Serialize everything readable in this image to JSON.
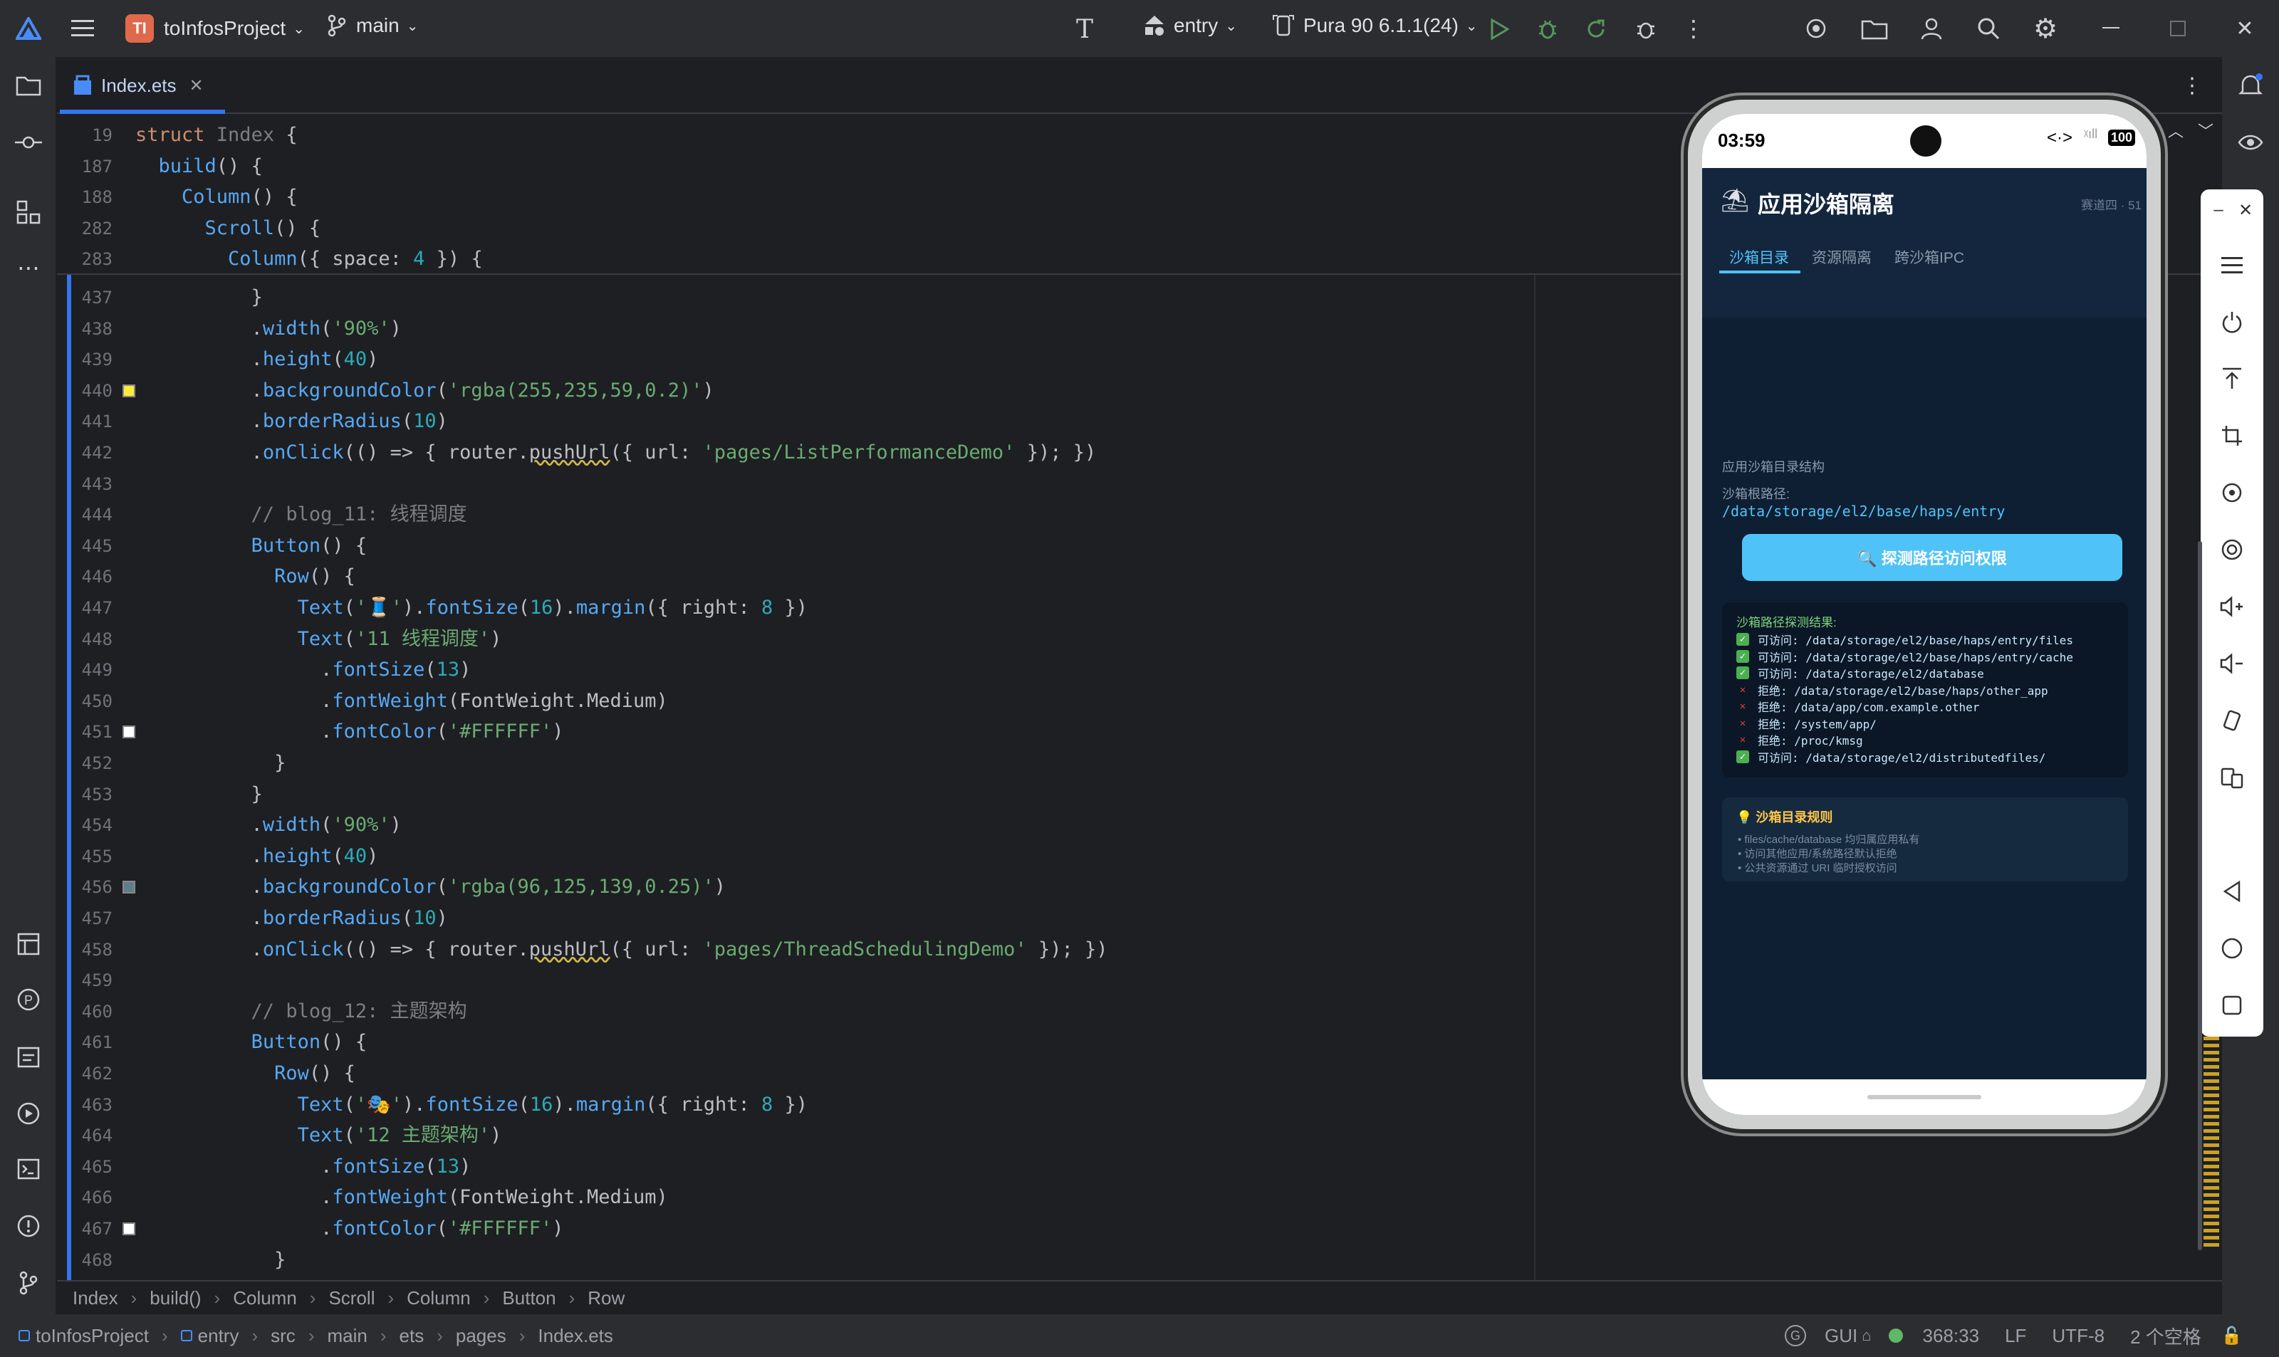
{
  "titlebar": {
    "project_badge": "TI",
    "project_name": "toInfosProject",
    "branch": "main",
    "run_config": "entry",
    "device": "Pura 90 6.1.1(24)"
  },
  "tab": {
    "file_name": "Index.ets"
  },
  "sticky_lines": [
    {
      "ln": "19",
      "tokens": [
        [
          "k",
          "struct "
        ],
        [
          "c",
          "Index "
        ],
        [
          "t",
          "{"
        ]
      ]
    },
    {
      "ln": "187",
      "tokens": [
        [
          "t",
          "  "
        ],
        [
          "f",
          "build"
        ],
        [
          "t",
          "() {"
        ]
      ]
    },
    {
      "ln": "188",
      "tokens": [
        [
          "t",
          "    "
        ],
        [
          "f",
          "Column"
        ],
        [
          "t",
          "() {"
        ]
      ]
    },
    {
      "ln": "282",
      "tokens": [
        [
          "t",
          "      "
        ],
        [
          "f",
          "Scroll"
        ],
        [
          "t",
          "() {"
        ]
      ]
    },
    {
      "ln": "283",
      "tokens": [
        [
          "t",
          "        "
        ],
        [
          "f",
          "Column"
        ],
        [
          "t",
          "({ space: "
        ],
        [
          "n",
          "4"
        ],
        [
          "t",
          " }) {"
        ]
      ]
    }
  ],
  "code_lines": [
    {
      "ln": "437",
      "tokens": [
        [
          "t",
          "          }"
        ]
      ]
    },
    {
      "ln": "438",
      "tokens": [
        [
          "t",
          "          ."
        ],
        [
          "f",
          "width"
        ],
        [
          "t",
          "("
        ],
        [
          "s",
          "'90%'"
        ],
        [
          "t",
          ")"
        ]
      ]
    },
    {
      "ln": "439",
      "tokens": [
        [
          "t",
          "          ."
        ],
        [
          "f",
          "height"
        ],
        [
          "t",
          "("
        ],
        [
          "n",
          "40"
        ],
        [
          "t",
          ")"
        ]
      ]
    },
    {
      "ln": "440",
      "tokens": [
        [
          "t",
          "          ."
        ],
        [
          "f",
          "backgroundColor"
        ],
        [
          "t",
          "("
        ],
        [
          "s",
          "'rgba(255,235,59,0.2)'"
        ],
        [
          "t",
          ")"
        ]
      ]
    },
    {
      "ln": "441",
      "tokens": [
        [
          "t",
          "          ."
        ],
        [
          "f",
          "borderRadius"
        ],
        [
          "t",
          "("
        ],
        [
          "n",
          "10"
        ],
        [
          "t",
          ")"
        ]
      ]
    },
    {
      "ln": "442",
      "tokens": [
        [
          "t",
          "          ."
        ],
        [
          "f",
          "onClick"
        ],
        [
          "t",
          "(() => { router."
        ],
        [
          "u",
          "pushUrl"
        ],
        [
          "t",
          "({ url: "
        ],
        [
          "s",
          "'pages/ListPerformanceDemo'"
        ],
        [
          "t",
          " }); })"
        ]
      ]
    },
    {
      "ln": "443",
      "tokens": [
        [
          "t",
          ""
        ]
      ]
    },
    {
      "ln": "444",
      "tokens": [
        [
          "c",
          "          // blog_11: 线程调度"
        ]
      ]
    },
    {
      "ln": "445",
      "tokens": [
        [
          "t",
          "          "
        ],
        [
          "f",
          "Button"
        ],
        [
          "t",
          "() {"
        ]
      ]
    },
    {
      "ln": "446",
      "tokens": [
        [
          "t",
          "            "
        ],
        [
          "f",
          "Row"
        ],
        [
          "t",
          "() {"
        ]
      ]
    },
    {
      "ln": "447",
      "tokens": [
        [
          "t",
          "              "
        ],
        [
          "f",
          "Text"
        ],
        [
          "t",
          "("
        ],
        [
          "s",
          "'🧵'"
        ],
        [
          "t",
          ")."
        ],
        [
          "f",
          "fontSize"
        ],
        [
          "t",
          "("
        ],
        [
          "n",
          "16"
        ],
        [
          "t",
          ")."
        ],
        [
          "f",
          "margin"
        ],
        [
          "t",
          "({ right: "
        ],
        [
          "n",
          "8"
        ],
        [
          "t",
          " })"
        ]
      ]
    },
    {
      "ln": "448",
      "tokens": [
        [
          "t",
          "              "
        ],
        [
          "f",
          "Text"
        ],
        [
          "t",
          "("
        ],
        [
          "s",
          "'11 线程调度'"
        ],
        [
          "t",
          ")"
        ]
      ]
    },
    {
      "ln": "449",
      "tokens": [
        [
          "t",
          "                ."
        ],
        [
          "f",
          "fontSize"
        ],
        [
          "t",
          "("
        ],
        [
          "n",
          "13"
        ],
        [
          "t",
          ")"
        ]
      ]
    },
    {
      "ln": "450",
      "tokens": [
        [
          "t",
          "                ."
        ],
        [
          "f",
          "fontWeight"
        ],
        [
          "t",
          "(FontWeight.Medium)"
        ]
      ]
    },
    {
      "ln": "451",
      "tokens": [
        [
          "t",
          "                ."
        ],
        [
          "f",
          "fontColor"
        ],
        [
          "t",
          "("
        ],
        [
          "s",
          "'#FFFFFF'"
        ],
        [
          "t",
          ")"
        ]
      ]
    },
    {
      "ln": "452",
      "tokens": [
        [
          "t",
          "            }"
        ]
      ]
    },
    {
      "ln": "453",
      "tokens": [
        [
          "t",
          "          }"
        ]
      ]
    },
    {
      "ln": "454",
      "tokens": [
        [
          "t",
          "          ."
        ],
        [
          "f",
          "width"
        ],
        [
          "t",
          "("
        ],
        [
          "s",
          "'90%'"
        ],
        [
          "t",
          ")"
        ]
      ]
    },
    {
      "ln": "455",
      "tokens": [
        [
          "t",
          "          ."
        ],
        [
          "f",
          "height"
        ],
        [
          "t",
          "("
        ],
        [
          "n",
          "40"
        ],
        [
          "t",
          ")"
        ]
      ]
    },
    {
      "ln": "456",
      "tokens": [
        [
          "t",
          "          ."
        ],
        [
          "f",
          "backgroundColor"
        ],
        [
          "t",
          "("
        ],
        [
          "s",
          "'rgba(96,125,139,0.25)'"
        ],
        [
          "t",
          ")"
        ]
      ]
    },
    {
      "ln": "457",
      "tokens": [
        [
          "t",
          "          ."
        ],
        [
          "f",
          "borderRadius"
        ],
        [
          "t",
          "("
        ],
        [
          "n",
          "10"
        ],
        [
          "t",
          ")"
        ]
      ]
    },
    {
      "ln": "458",
      "tokens": [
        [
          "t",
          "          ."
        ],
        [
          "f",
          "onClick"
        ],
        [
          "t",
          "(() => { router."
        ],
        [
          "u",
          "pushUrl"
        ],
        [
          "t",
          "({ url: "
        ],
        [
          "s",
          "'pages/ThreadSchedulingDemo'"
        ],
        [
          "t",
          " }); })"
        ]
      ]
    },
    {
      "ln": "459",
      "tokens": [
        [
          "t",
          ""
        ]
      ]
    },
    {
      "ln": "460",
      "tokens": [
        [
          "c",
          "          // blog_12: 主题架构"
        ]
      ]
    },
    {
      "ln": "461",
      "tokens": [
        [
          "t",
          "          "
        ],
        [
          "f",
          "Button"
        ],
        [
          "t",
          "() {"
        ]
      ]
    },
    {
      "ln": "462",
      "tokens": [
        [
          "t",
          "            "
        ],
        [
          "f",
          "Row"
        ],
        [
          "t",
          "() {"
        ]
      ]
    },
    {
      "ln": "463",
      "tokens": [
        [
          "t",
          "              "
        ],
        [
          "f",
          "Text"
        ],
        [
          "t",
          "("
        ],
        [
          "s",
          "'🎭'"
        ],
        [
          "t",
          ")."
        ],
        [
          "f",
          "fontSize"
        ],
        [
          "t",
          "("
        ],
        [
          "n",
          "16"
        ],
        [
          "t",
          ")."
        ],
        [
          "f",
          "margin"
        ],
        [
          "t",
          "({ right: "
        ],
        [
          "n",
          "8"
        ],
        [
          "t",
          " })"
        ]
      ]
    },
    {
      "ln": "464",
      "tokens": [
        [
          "t",
          "              "
        ],
        [
          "f",
          "Text"
        ],
        [
          "t",
          "("
        ],
        [
          "s",
          "'12 主题架构'"
        ],
        [
          "t",
          ")"
        ]
      ]
    },
    {
      "ln": "465",
      "tokens": [
        [
          "t",
          "                ."
        ],
        [
          "f",
          "fontSize"
        ],
        [
          "t",
          "("
        ],
        [
          "n",
          "13"
        ],
        [
          "t",
          ")"
        ]
      ]
    },
    {
      "ln": "466",
      "tokens": [
        [
          "t",
          "                ."
        ],
        [
          "f",
          "fontWeight"
        ],
        [
          "t",
          "(FontWeight.Medium)"
        ]
      ]
    },
    {
      "ln": "467",
      "tokens": [
        [
          "t",
          "                ."
        ],
        [
          "f",
          "fontColor"
        ],
        [
          "t",
          "("
        ],
        [
          "s",
          "'#FFFFFF'"
        ],
        [
          "t",
          ")"
        ]
      ]
    },
    {
      "ln": "468",
      "tokens": [
        [
          "t",
          "            }"
        ]
      ]
    }
  ],
  "gutter_colors": {
    "440": "#ffeb3b",
    "451": "#ffffff",
    "456": "#607d8b",
    "467": "#ffffff"
  },
  "breadcrumb": [
    "Index",
    "build()",
    "Column",
    "Scroll",
    "Column",
    "Button",
    "Row"
  ],
  "status": {
    "path": [
      "toInfosProject",
      "entry",
      "src",
      "main",
      "ets",
      "pages",
      "Index.ets"
    ],
    "gui": "GUI",
    "position": "368:33",
    "line_sep": "LF",
    "encoding": "UTF-8",
    "indent": "2 个空格"
  },
  "phone": {
    "time": "03:59",
    "battery": "100",
    "app_title": "应用沙箱隔离",
    "app_subtitle": "赛道四 · 51",
    "tabs": [
      "沙箱目录",
      "资源隔离",
      "跨沙箱IPC"
    ],
    "section_title": "应用沙箱目录结构",
    "root_label": "沙箱根路径:",
    "root_path": "/data/storage/el2/base/haps/entry",
    "probe_button": "🔍 探测路径访问权限",
    "result_title": "沙箱路径探测结果:",
    "results": [
      {
        "ok": true,
        "text": "可访问: /data/storage/el2/base/haps/entry/files"
      },
      {
        "ok": true,
        "text": "可访问: /data/storage/el2/base/haps/entry/cache"
      },
      {
        "ok": true,
        "text": "可访问: /data/storage/el2/database"
      },
      {
        "ok": false,
        "text": "拒绝: /data/storage/el2/base/haps/other_app"
      },
      {
        "ok": false,
        "text": "拒绝: /data/app/com.example.other"
      },
      {
        "ok": false,
        "text": "拒绝: /system/app/"
      },
      {
        "ok": false,
        "text": "拒绝: /proc/kmsg"
      },
      {
        "ok": true,
        "text": "可访问: /data/storage/el2/distributedfiles/"
      }
    ],
    "rules_title": "💡 沙箱目录规则",
    "rules": [
      "• files/cache/database 均归属应用私有",
      "• 访问其他应用/系统路径默认拒绝",
      "• 公共资源通过 URI 临时授权访问"
    ]
  },
  "colors": {
    "accent": "#3574f0",
    "phone_accent": "#4fc3f7",
    "ok": "#4caf50",
    "deny": "#e53935"
  }
}
